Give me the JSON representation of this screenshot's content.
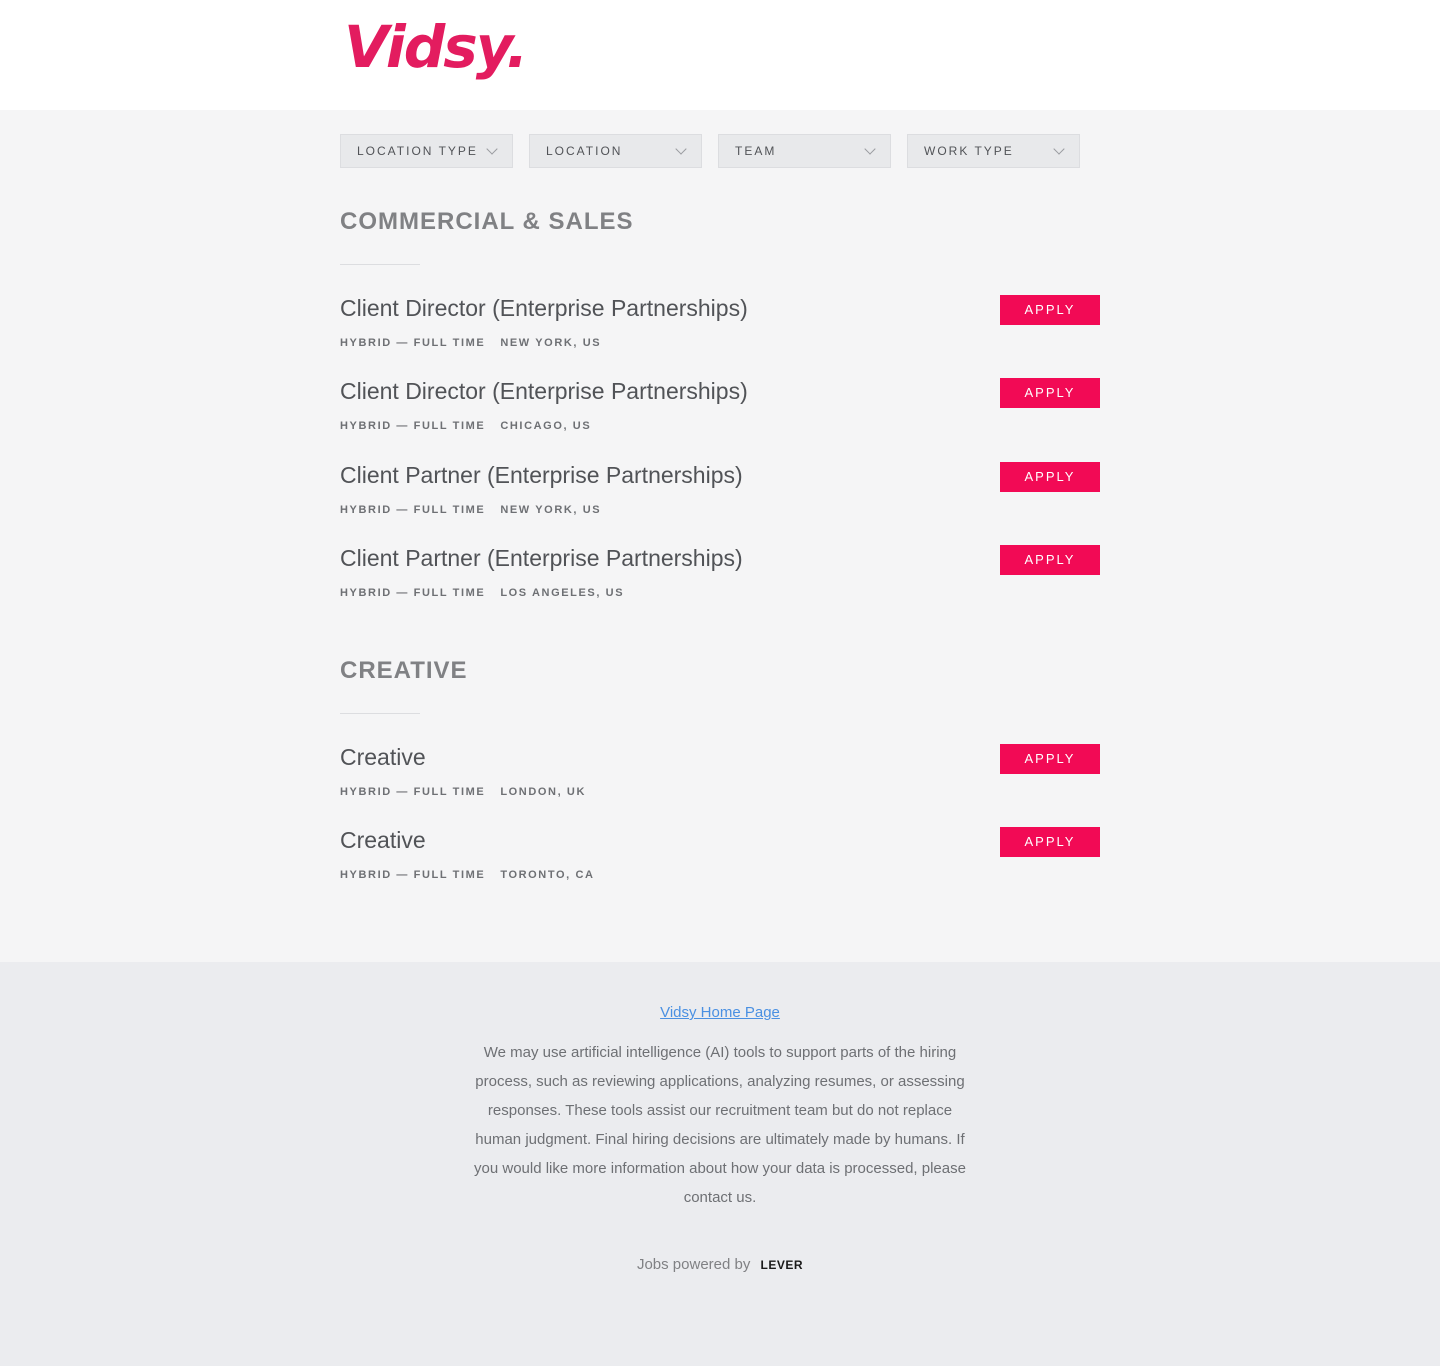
{
  "header": {
    "logo_text": "Vidsy."
  },
  "filters": [
    {
      "label": "LOCATION TYPE"
    },
    {
      "label": "LOCATION"
    },
    {
      "label": "TEAM"
    },
    {
      "label": "WORK TYPE"
    }
  ],
  "sections": [
    {
      "title": "COMMERCIAL & SALES",
      "postings": [
        {
          "title": "Client Director (Enterprise Partnerships)",
          "commitment": "HYBRID — FULL TIME",
          "location": "NEW YORK, US",
          "apply": "APPLY"
        },
        {
          "title": "Client Director (Enterprise Partnerships)",
          "commitment": "HYBRID — FULL TIME",
          "location": "CHICAGO, US",
          "apply": "APPLY"
        },
        {
          "title": "Client Partner (Enterprise Partnerships)",
          "commitment": "HYBRID — FULL TIME",
          "location": "NEW YORK, US",
          "apply": "APPLY"
        },
        {
          "title": "Client Partner (Enterprise Partnerships)",
          "commitment": "HYBRID — FULL TIME",
          "location": "LOS ANGELES, US",
          "apply": "APPLY"
        }
      ]
    },
    {
      "title": "CREATIVE",
      "postings": [
        {
          "title": "Creative",
          "commitment": "HYBRID — FULL TIME",
          "location": "LONDON, UK",
          "apply": "APPLY"
        },
        {
          "title": "Creative",
          "commitment": "HYBRID — FULL TIME",
          "location": "TORONTO, CA",
          "apply": "APPLY"
        }
      ]
    }
  ],
  "footer": {
    "home_link": "Vidsy Home Page",
    "ai_notice": "We may use artificial intelligence (AI) tools to support parts of the hiring process, such as reviewing applications, analyzing resumes, or assessing responses. These tools assist our recruitment team but do not replace human judgment. Final hiring decisions are ultimately made by humans. If you would like more information about how your data is processed, please contact us.",
    "powered_by": "Jobs powered by",
    "powered_brand": "LEVER"
  },
  "colors": {
    "brand": "#e31c5f",
    "apply_button": "#f20a55",
    "link": "#4a90e2"
  }
}
